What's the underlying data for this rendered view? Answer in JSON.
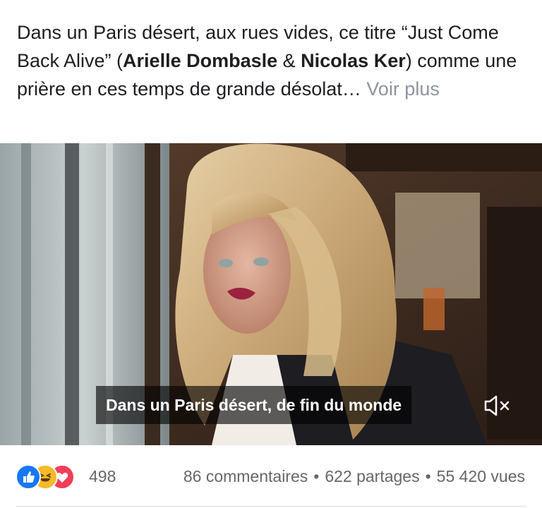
{
  "post": {
    "text_part1": "Dans un Paris désert, aux rues vides, ce titre “Just Come Back Alive” (",
    "artist1": "Arielle Dombasle",
    "text_amp": " & ",
    "artist2": "Nicolas Ker",
    "text_part2": ") comme une prière en ces temps de grande désolat…",
    "see_more": " Voir plus"
  },
  "video": {
    "caption": "Dans un Paris désert, de fin du monde",
    "mute_icon": "speaker-muted-icon"
  },
  "footer": {
    "reaction_icons": [
      "like-icon",
      "haha-icon",
      "love-icon"
    ],
    "reaction_count": "498",
    "comments": "86 commentaires",
    "separator": "•",
    "shares": "622 partages",
    "views": "55 420 vues"
  },
  "colors": {
    "like": "#1877f2",
    "haha": "#f7b928",
    "love": "#f33e58",
    "meta_text": "#65676b",
    "see_more": "#8d949e"
  }
}
